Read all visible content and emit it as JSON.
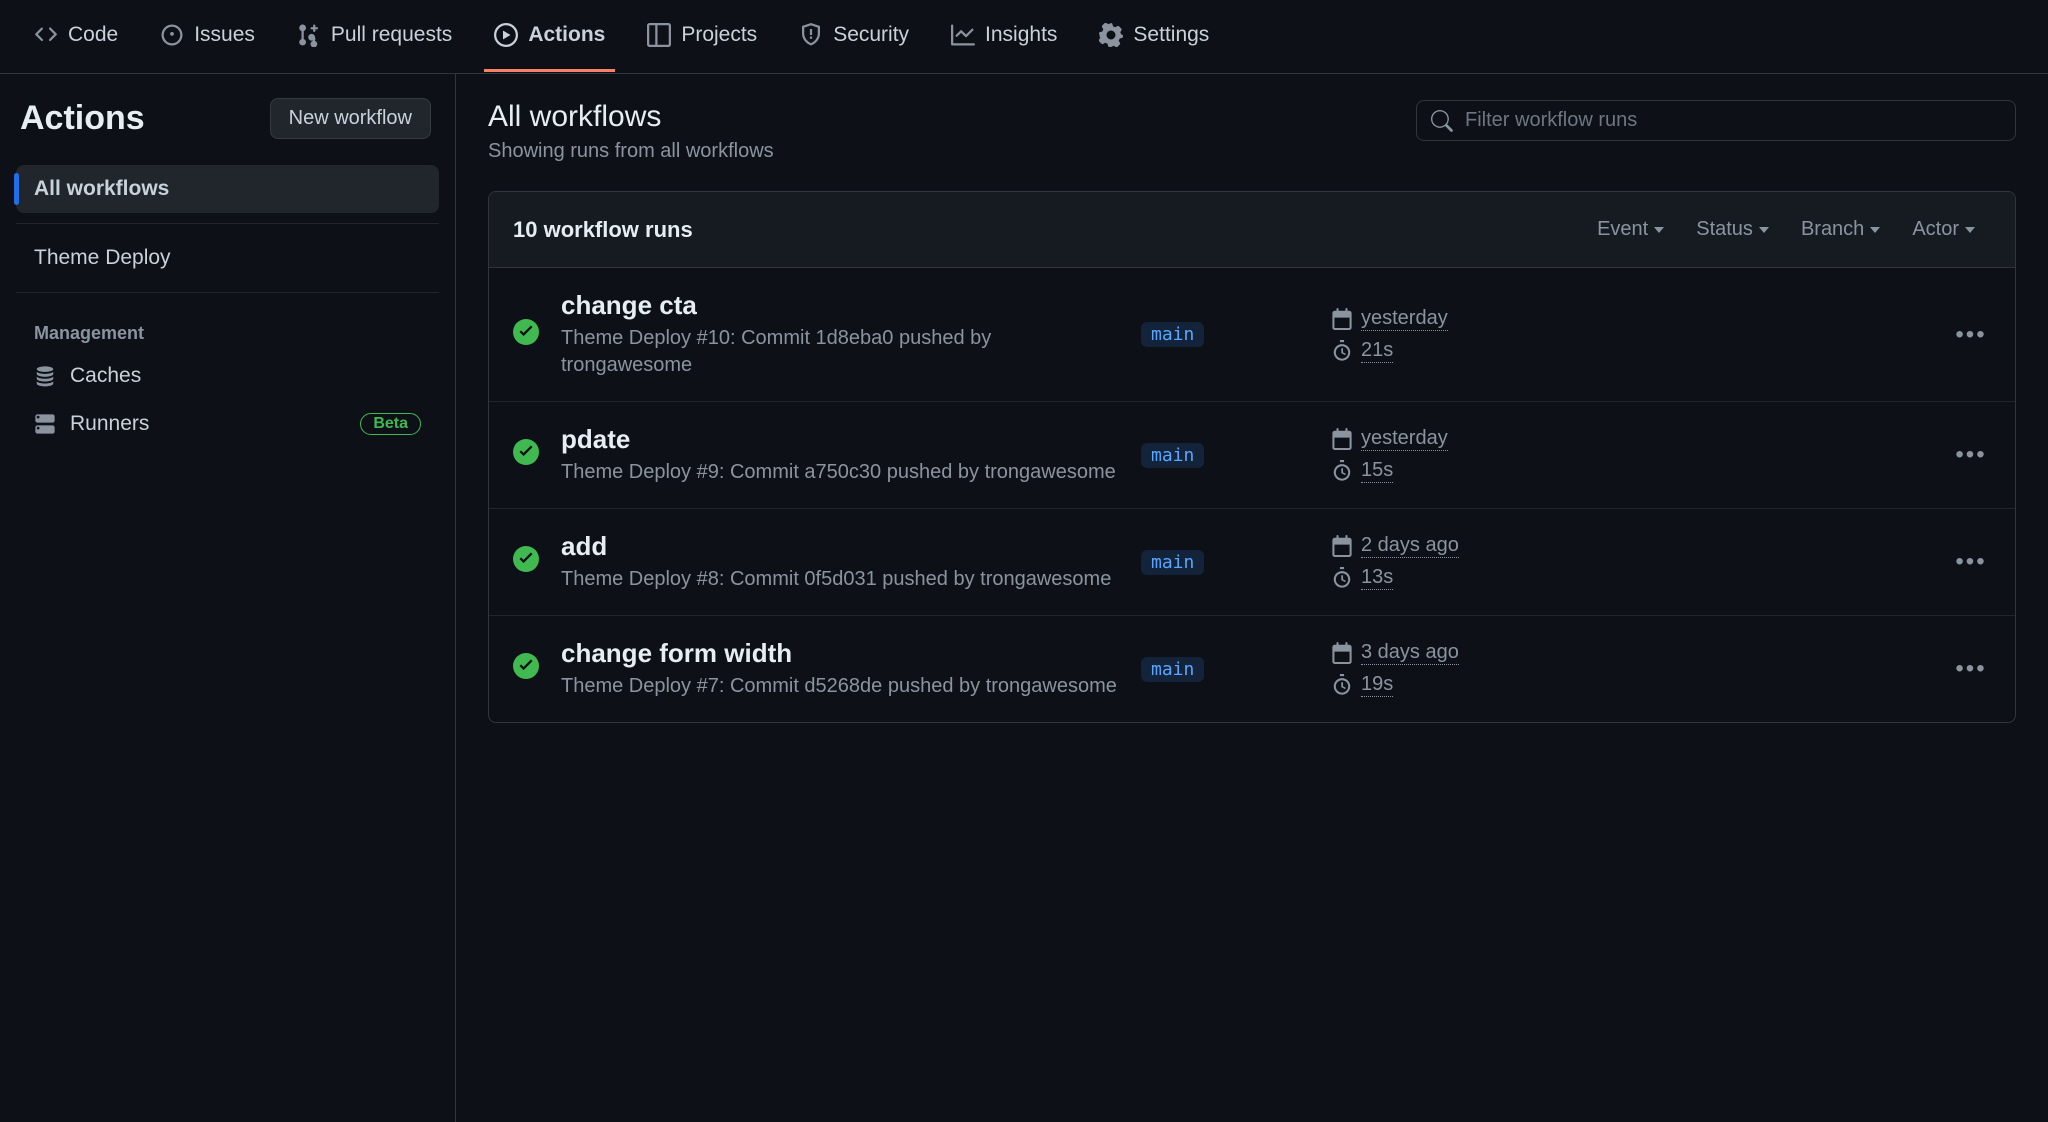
{
  "nav": {
    "items": [
      {
        "label": "Code",
        "icon": "code"
      },
      {
        "label": "Issues",
        "icon": "issue"
      },
      {
        "label": "Pull requests",
        "icon": "pr"
      },
      {
        "label": "Actions",
        "icon": "play",
        "active": true
      },
      {
        "label": "Projects",
        "icon": "table"
      },
      {
        "label": "Security",
        "icon": "shield"
      },
      {
        "label": "Insights",
        "icon": "graph"
      },
      {
        "label": "Settings",
        "icon": "gear"
      }
    ]
  },
  "sidebar": {
    "title": "Actions",
    "new_workflow": "New workflow",
    "all_workflows": "All workflows",
    "workflows": [
      {
        "label": "Theme Deploy"
      }
    ],
    "management_label": "Management",
    "caches": "Caches",
    "runners": "Runners",
    "beta": "Beta"
  },
  "main": {
    "title": "All workflows",
    "subtitle": "Showing runs from all workflows",
    "search_placeholder": "Filter workflow runs",
    "runs_count": "10 workflow runs",
    "filters": {
      "event": "Event",
      "status": "Status",
      "branch": "Branch",
      "actor": "Actor"
    },
    "runs": [
      {
        "title": "change cta",
        "workflow": "Theme Deploy",
        "detail": "#10: Commit 1d8eba0 pushed by trongawesome",
        "branch": "main",
        "date": "yesterday",
        "duration": "21s"
      },
      {
        "title": "pdate",
        "workflow": "Theme Deploy",
        "detail": "#9: Commit a750c30 pushed by trongawesome",
        "branch": "main",
        "date": "yesterday",
        "duration": "15s"
      },
      {
        "title": "add",
        "workflow": "Theme Deploy",
        "detail": "#8: Commit 0f5d031 pushed by trongawesome",
        "branch": "main",
        "date": "2 days ago",
        "duration": "13s"
      },
      {
        "title": "change form width",
        "workflow": "Theme Deploy",
        "detail": "#7: Commit d5268de pushed by trongawesome",
        "branch": "main",
        "date": "3 days ago",
        "duration": "19s"
      }
    ]
  }
}
